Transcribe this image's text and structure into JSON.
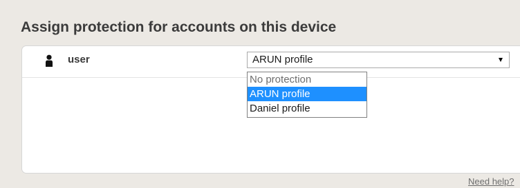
{
  "heading": "Assign protection for accounts on this device",
  "account": {
    "icon": "user-icon",
    "name": "user"
  },
  "protection_select": {
    "selected_value": "ARUN profile",
    "options": [
      {
        "label": "No protection",
        "highlighted": false
      },
      {
        "label": "ARUN profile",
        "highlighted": true
      },
      {
        "label": "Daniel profile",
        "highlighted": false
      }
    ],
    "highlight_color": "#1e90ff"
  },
  "footer": {
    "help_link": "Need help?"
  }
}
